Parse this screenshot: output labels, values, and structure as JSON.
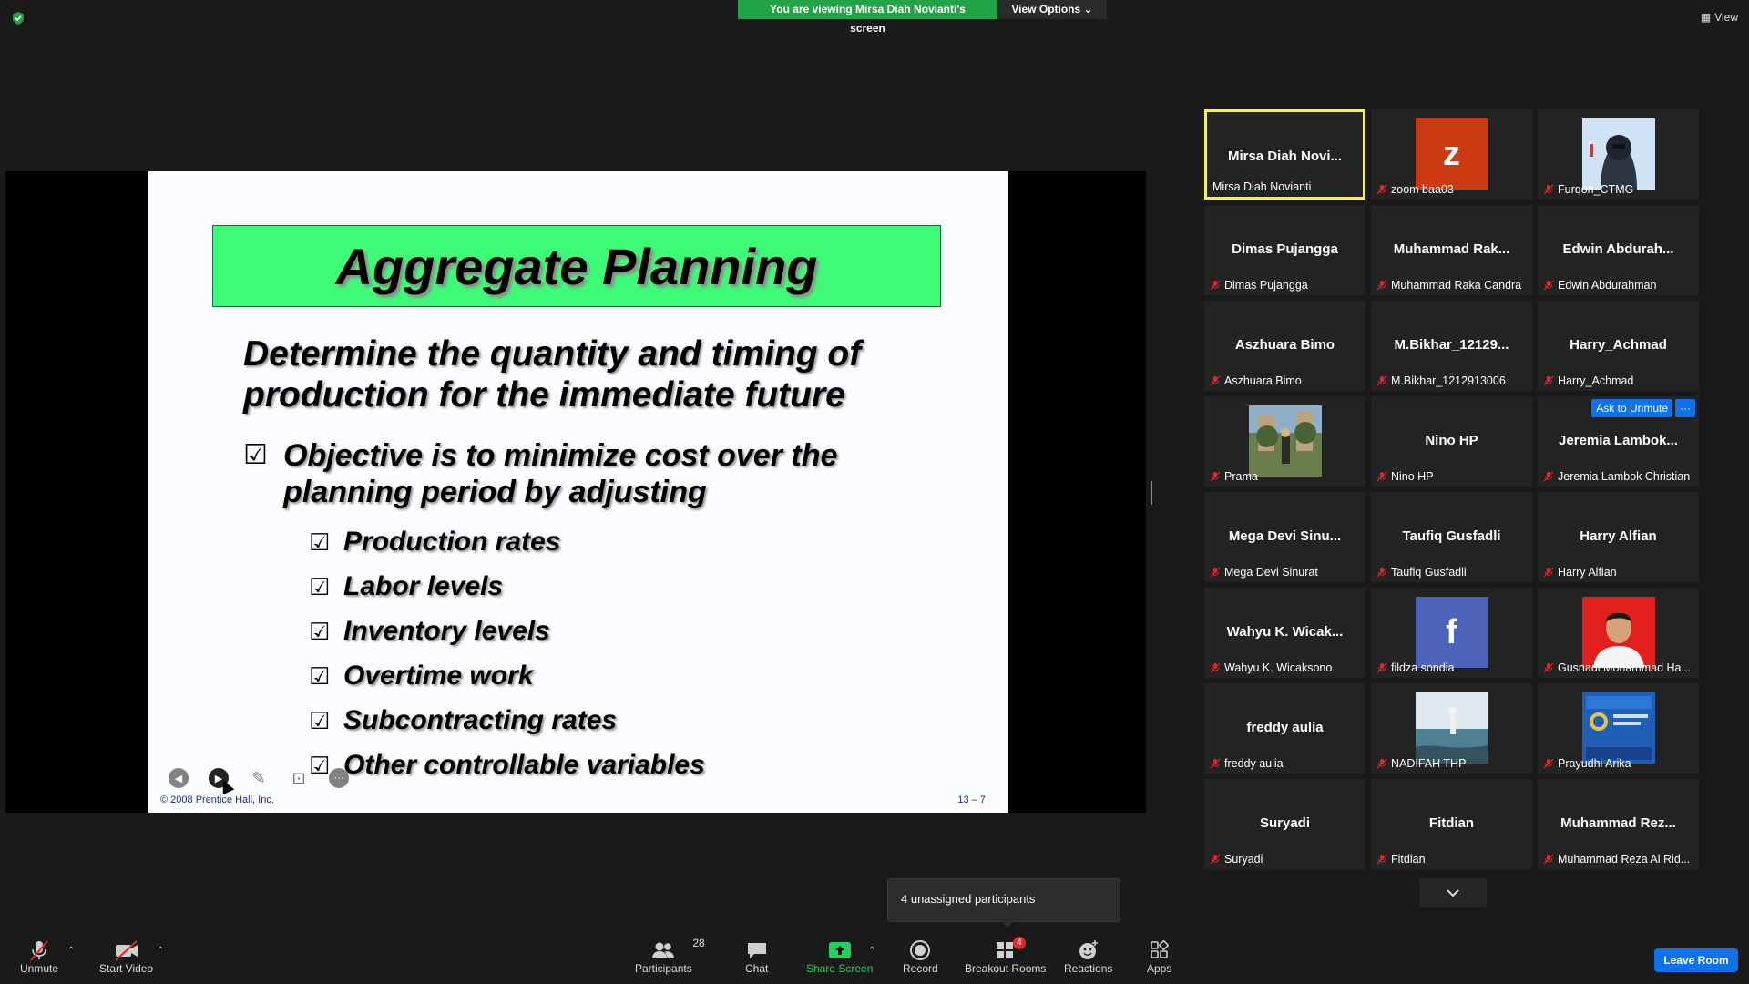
{
  "banner": {
    "viewing": "You are viewing Mirsa Diah Novianti's screen",
    "view_options": "View Options"
  },
  "top_view_label": "View",
  "slide": {
    "title": "Aggregate Planning",
    "heading": "Determine the quantity and timing of production for the immediate future",
    "objective": "Objective is to minimize cost over the planning period by adjusting",
    "sub_items": [
      "Production rates",
      "Labor levels",
      "Inventory levels",
      "Overtime work",
      "Subcontracting rates",
      "Other controllable variables"
    ],
    "copyright": "© 2008 Prentice Hall, Inc.",
    "page_number": "13 – 7"
  },
  "gallery": [
    {
      "center": "Mirsa Diah Novi...",
      "label": "Mirsa Diah Novianti",
      "muted": false,
      "active": true
    },
    {
      "avatar": "z",
      "avatar_color": "#cc3a12",
      "label": "zoom baa03",
      "muted": true
    },
    {
      "photo": "hooded",
      "label": "Furqon_CTMG",
      "muted": true
    },
    {
      "center": "Dimas Pujangga",
      "label": "Dimas Pujangga",
      "muted": true
    },
    {
      "center": "Muhammad Rak...",
      "label": "Muhammad Raka Candra",
      "muted": true
    },
    {
      "center": "Edwin Abdurah...",
      "label": "Edwin Abdurahman",
      "muted": true
    },
    {
      "center": "Aszhuara Bimo",
      "label": "Aszhuara Bimo",
      "muted": true
    },
    {
      "center": "M.Bikhar_12129...",
      "label": "M.Bikhar_1212913006",
      "muted": true
    },
    {
      "center": "Harry_Achmad",
      "label": "Harry_Achmad",
      "muted": true
    },
    {
      "photo": "garden",
      "label": "Prama",
      "muted": true
    },
    {
      "center": "Nino HP",
      "label": "Nino HP",
      "muted": true
    },
    {
      "center": "Jeremia Lambok...",
      "label": "Jeremia Lambok Christian",
      "muted": true,
      "ask": "Ask to Unmute",
      "ask_more": "···"
    },
    {
      "center": "Mega Devi Sinu...",
      "label": "Mega Devi Sinurat",
      "muted": true
    },
    {
      "center": "Taufiq Gusfadli",
      "label": "Taufiq Gusfadli",
      "muted": true
    },
    {
      "center": "Harry Alfian",
      "label": "Harry Alfian",
      "muted": true
    },
    {
      "center": "Wahyu K. Wicak...",
      "label": "Wahyu K. Wicaksono",
      "muted": true
    },
    {
      "avatar": "f",
      "avatar_color": "#4b63b8",
      "label": "fildza sondia",
      "muted": true
    },
    {
      "photo": "portrait-red",
      "label": "Gusnadi Mohammad Ha...",
      "muted": true
    },
    {
      "center": "freddy aulia",
      "label": "freddy aulia",
      "muted": true
    },
    {
      "photo": "sea",
      "label": "NADIFAH THP",
      "muted": true
    },
    {
      "photo": "poster-blue",
      "label": "Prayudhi Arika",
      "muted": true
    },
    {
      "center": "Suryadi",
      "label": "Suryadi",
      "muted": true
    },
    {
      "center": "Fitdian",
      "label": "Fitdian",
      "muted": true
    },
    {
      "center": "Muhammad Rez...",
      "label": "Muhammad Reza Al Rid...",
      "muted": true
    }
  ],
  "unassigned_tooltip": "4 unassigned participants",
  "toolbar": {
    "unmute": "Unmute",
    "start_video": "Start Video",
    "participants": "Participants",
    "participants_count": "28",
    "chat": "Chat",
    "share_screen": "Share Screen",
    "record": "Record",
    "breakout_rooms": "Breakout Rooms",
    "breakout_badge": "4",
    "reactions": "Reactions",
    "apps": "Apps",
    "leave_room": "Leave Room"
  },
  "colors": {
    "share_green": "#23a347",
    "accent_blue": "#0e72ed",
    "active_border": "#f1f06d",
    "slide_title_bg": "#3efb77"
  }
}
